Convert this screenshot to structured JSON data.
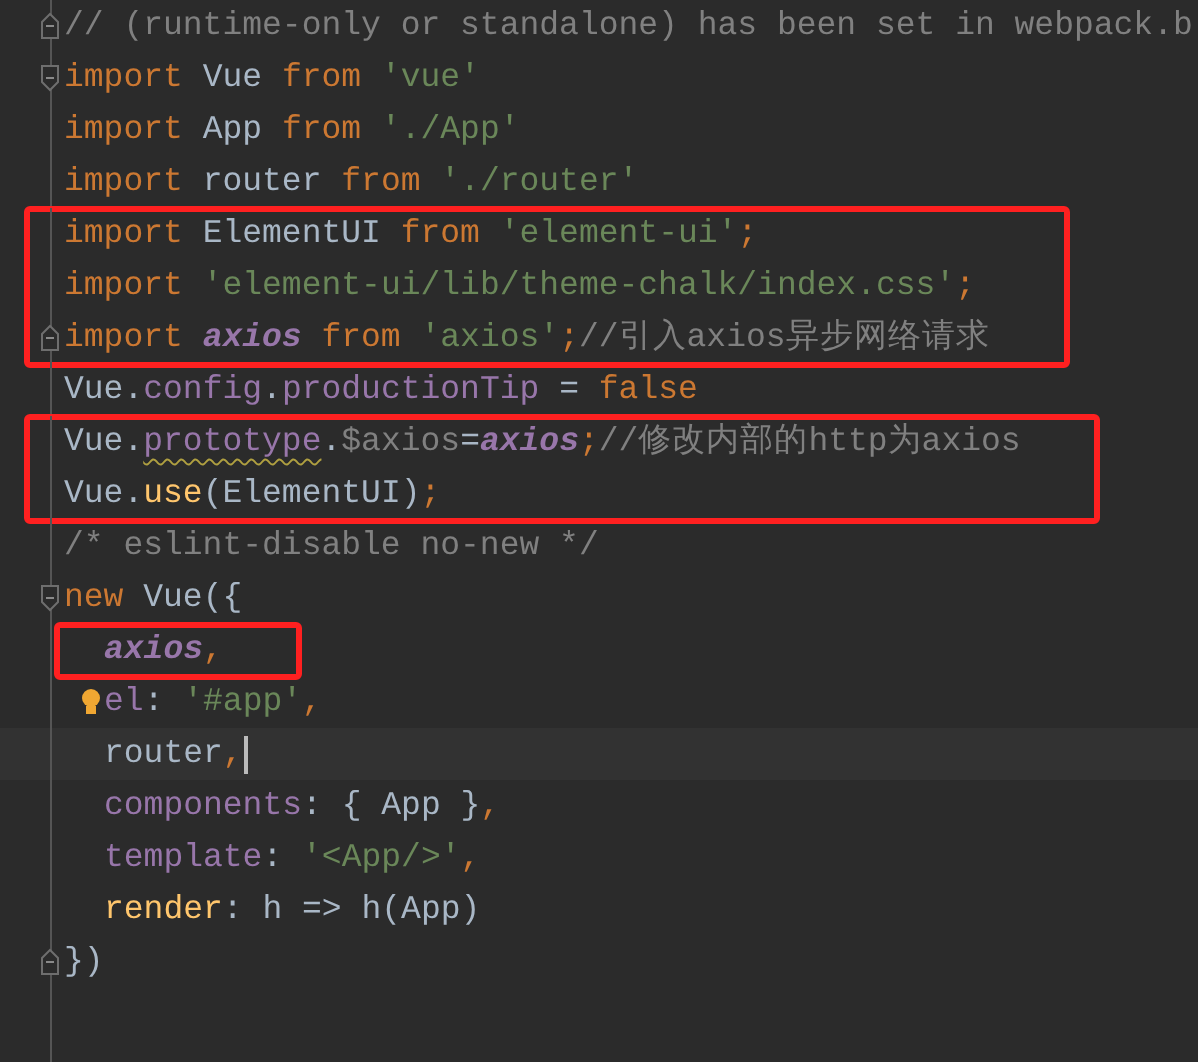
{
  "lines": [
    {
      "kind": "line",
      "fold_end": true,
      "tokens": [
        {
          "text": "// (runtime-only or standalone) has been set in webpack.b",
          "kind": "comment"
        }
      ]
    },
    {
      "kind": "line",
      "fold_start": true,
      "tokens": [
        {
          "text": "import",
          "kind": "keyword"
        },
        {
          "text": " Vue ",
          "kind": "plain"
        },
        {
          "text": "from",
          "kind": "keyword"
        },
        {
          "text": " 'vue'",
          "kind": "string"
        }
      ]
    },
    {
      "kind": "line",
      "tokens": [
        {
          "text": "import",
          "kind": "keyword"
        },
        {
          "text": " App ",
          "kind": "plain"
        },
        {
          "text": "from",
          "kind": "keyword"
        },
        {
          "text": " './App'",
          "kind": "string"
        }
      ]
    },
    {
      "kind": "line",
      "tokens": [
        {
          "text": "import",
          "kind": "keyword"
        },
        {
          "text": " router ",
          "kind": "plain"
        },
        {
          "text": "from",
          "kind": "keyword"
        },
        {
          "text": " './router'",
          "kind": "string"
        }
      ]
    },
    {
      "kind": "group",
      "highlighted": true,
      "lines": [
        {
          "kind": "line",
          "tokens": [
            {
              "text": "import",
              "kind": "keyword"
            },
            {
              "text": " ElementUI ",
              "kind": "plain"
            },
            {
              "text": "from",
              "kind": "keyword"
            },
            {
              "text": " 'element-ui'",
              "kind": "string"
            },
            {
              "text": ";",
              "kind": "keyword"
            }
          ]
        },
        {
          "kind": "line",
          "tokens": [
            {
              "text": "import",
              "kind": "keyword"
            },
            {
              "text": " 'element-ui/lib/theme-chalk/index.css'",
              "kind": "string"
            },
            {
              "text": ";",
              "kind": "keyword"
            }
          ]
        },
        {
          "kind": "line",
          "fold_end": true,
          "tokens": [
            {
              "text": "import ",
              "kind": "keyword"
            },
            {
              "text": "axios",
              "kind": "global"
            },
            {
              "text": " from",
              "kind": "keyword"
            },
            {
              "text": " 'axios'",
              "kind": "string"
            },
            {
              "text": ";",
              "kind": "keyword"
            },
            {
              "text": "//引入axios异步网络请求",
              "kind": "comment"
            }
          ]
        }
      ]
    },
    {
      "kind": "line",
      "tokens": [
        {
          "text": "Vue.",
          "kind": "plain"
        },
        {
          "text": "config",
          "kind": "property"
        },
        {
          "text": ".",
          "kind": "plain"
        },
        {
          "text": "productionTip",
          "kind": "property"
        },
        {
          "text": " = ",
          "kind": "plain"
        },
        {
          "text": "false",
          "kind": "keyword"
        }
      ]
    },
    {
      "kind": "group",
      "highlighted": true,
      "lines": [
        {
          "kind": "line",
          "tokens": [
            {
              "text": "Vue.",
              "kind": "plain"
            },
            {
              "text": "prototype",
              "kind": "property",
              "warning": true
            },
            {
              "text": ".",
              "kind": "plain"
            },
            {
              "text": "$axios",
              "kind": "muted"
            },
            {
              "text": "=",
              "kind": "plain"
            },
            {
              "text": "axios",
              "kind": "global"
            },
            {
              "text": ";",
              "kind": "keyword"
            },
            {
              "text": "//修改内部的http为axios",
              "kind": "comment"
            }
          ]
        },
        {
          "kind": "line",
          "tokens": [
            {
              "text": "Vue.",
              "kind": "plain"
            },
            {
              "text": "use",
              "kind": "function"
            },
            {
              "text": "(ElementUI)",
              "kind": "plain"
            },
            {
              "text": ";",
              "kind": "keyword"
            }
          ]
        }
      ]
    },
    {
      "kind": "line",
      "tokens": [
        {
          "text": "/* eslint-disable no-new */",
          "kind": "comment"
        }
      ]
    },
    {
      "kind": "line",
      "fold_start": true,
      "tokens": [
        {
          "text": "new",
          "kind": "keyword"
        },
        {
          "text": " Vue({",
          "kind": "plain"
        }
      ],
      "children": [
        {
          "kind": "group",
          "highlighted": true,
          "lines": [
            {
              "kind": "line",
              "tokens": [
                {
                  "text": "axios",
                  "kind": "global"
                },
                {
                  "text": ",",
                  "kind": "keyword"
                }
              ]
            }
          ]
        },
        {
          "kind": "line",
          "hint": true,
          "tokens": [
            {
              "text": "el",
              "kind": "property"
            },
            {
              "text": ": ",
              "kind": "plain"
            },
            {
              "text": "'#app'",
              "kind": "string"
            },
            {
              "text": ",",
              "kind": "keyword"
            }
          ]
        },
        {
          "kind": "line",
          "current": true,
          "tokens": [
            {
              "text": "router",
              "kind": "plain"
            },
            {
              "text": ",",
              "kind": "keyword"
            }
          ]
        },
        {
          "kind": "line",
          "tokens": [
            {
              "text": "components",
              "kind": "property"
            },
            {
              "text": ": { App }",
              "kind": "plain"
            },
            {
              "text": ",",
              "kind": "keyword"
            }
          ]
        },
        {
          "kind": "line",
          "tokens": [
            {
              "text": "template",
              "kind": "property"
            },
            {
              "text": ": ",
              "kind": "plain"
            },
            {
              "text": "'<App/>'",
              "kind": "string"
            },
            {
              "text": ",",
              "kind": "keyword"
            }
          ]
        },
        {
          "kind": "line",
          "tokens": [
            {
              "text": "render",
              "kind": "function"
            },
            {
              "text": ": h => h(App)",
              "kind": "plain"
            }
          ]
        }
      ]
    },
    {
      "kind": "line",
      "fold_end": true,
      "tokens": [
        {
          "text": "})",
          "kind": "plain"
        }
      ]
    }
  ]
}
